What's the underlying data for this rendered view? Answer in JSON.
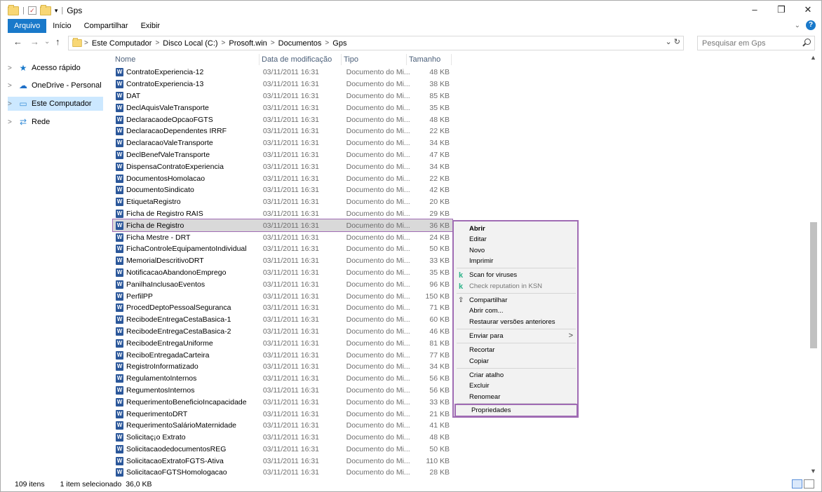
{
  "window": {
    "title": "Gps",
    "controls": {
      "minimize": "–",
      "maximize": "❐",
      "close": "✕"
    }
  },
  "ribbon": {
    "tabs": [
      "Arquivo",
      "Início",
      "Compartilhar",
      "Exibir"
    ],
    "help": "?",
    "collapse": "⌄"
  },
  "address": {
    "back": "←",
    "forward": "→",
    "recent": "⌄",
    "up": "↑",
    "breadcrumbs": [
      "Este Computador",
      "Disco Local (C:)",
      "Prosoft.win",
      "Documentos",
      "Gps"
    ],
    "refresh": "⌄ ↻",
    "search_placeholder": "Pesquisar em Gps"
  },
  "nav": {
    "items": [
      {
        "label": "Acesso rápido",
        "icon": "★"
      },
      {
        "label": "OneDrive - Personal",
        "icon": "☁"
      },
      {
        "label": "Este Computador",
        "icon": "▭"
      },
      {
        "label": "Rede",
        "icon": "⇄"
      }
    ]
  },
  "columns": {
    "name": "Nome",
    "date": "Data de modificação",
    "type": "Tipo",
    "size": "Tamanho"
  },
  "files": [
    {
      "name": "ContratoExperiencia-12",
      "date": "03/11/2011 16:31",
      "type": "Documento do Mi...",
      "size": "48 KB"
    },
    {
      "name": "ContratoExperiencia-13",
      "date": "03/11/2011 16:31",
      "type": "Documento do Mi...",
      "size": "38 KB"
    },
    {
      "name": "DAT",
      "date": "03/11/2011 16:31",
      "type": "Documento do Mi...",
      "size": "85 KB"
    },
    {
      "name": "DeclAquisValeTransporte",
      "date": "03/11/2011 16:31",
      "type": "Documento do Mi...",
      "size": "35 KB"
    },
    {
      "name": "DeclaracaodeOpcaoFGTS",
      "date": "03/11/2011 16:31",
      "type": "Documento do Mi...",
      "size": "48 KB"
    },
    {
      "name": "DeclaracaoDependentes IRRF",
      "date": "03/11/2011 16:31",
      "type": "Documento do Mi...",
      "size": "22 KB"
    },
    {
      "name": "DeclaracaoValeTransporte",
      "date": "03/11/2011 16:31",
      "type": "Documento do Mi...",
      "size": "34 KB"
    },
    {
      "name": "DeclBenefValeTransporte",
      "date": "03/11/2011 16:31",
      "type": "Documento do Mi...",
      "size": "47 KB"
    },
    {
      "name": "DispensaContratoExperiencia",
      "date": "03/11/2011 16:31",
      "type": "Documento do Mi...",
      "size": "34 KB"
    },
    {
      "name": "DocumentosHomolacao",
      "date": "03/11/2011 16:31",
      "type": "Documento do Mi...",
      "size": "22 KB"
    },
    {
      "name": "DocumentoSindicato",
      "date": "03/11/2011 16:31",
      "type": "Documento do Mi...",
      "size": "42 KB"
    },
    {
      "name": "EtiquetaRegistro",
      "date": "03/11/2011 16:31",
      "type": "Documento do Mi...",
      "size": "20 KB"
    },
    {
      "name": "Ficha de Registro RAIS",
      "date": "03/11/2011 16:31",
      "type": "Documento do Mi...",
      "size": "29 KB"
    },
    {
      "name": "Ficha de Registro",
      "date": "03/11/2011 16:31",
      "type": "Documento do Mi...",
      "size": "36 KB",
      "selected": true
    },
    {
      "name": "Ficha Mestre - DRT",
      "date": "03/11/2011 16:31",
      "type": "Documento do Mi...",
      "size": "24 KB"
    },
    {
      "name": "FichaControleEquipamentoIndividual",
      "date": "03/11/2011 16:31",
      "type": "Documento do Mi...",
      "size": "50 KB"
    },
    {
      "name": "MemorialDescritivoDRT",
      "date": "03/11/2011 16:31",
      "type": "Documento do Mi...",
      "size": "33 KB"
    },
    {
      "name": "NotificacaoAbandonoEmprego",
      "date": "03/11/2011 16:31",
      "type": "Documento do Mi...",
      "size": "35 KB"
    },
    {
      "name": "PanilhaInclusaoEventos",
      "date": "03/11/2011 16:31",
      "type": "Documento do Mi...",
      "size": "96 KB"
    },
    {
      "name": "PerfilPP",
      "date": "03/11/2011 16:31",
      "type": "Documento do Mi...",
      "size": "150 KB"
    },
    {
      "name": "ProcedDeptoPessoalSeguranca",
      "date": "03/11/2011 16:31",
      "type": "Documento do Mi...",
      "size": "71 KB"
    },
    {
      "name": "RecibodeEntregaCestaBasica-1",
      "date": "03/11/2011 16:31",
      "type": "Documento do Mi...",
      "size": "60 KB"
    },
    {
      "name": "RecibodeEntregaCestaBasica-2",
      "date": "03/11/2011 16:31",
      "type": "Documento do Mi...",
      "size": "46 KB"
    },
    {
      "name": "RecibodeEntregaUniforme",
      "date": "03/11/2011 16:31",
      "type": "Documento do Mi...",
      "size": "81 KB"
    },
    {
      "name": "ReciboEntregadaCarteira",
      "date": "03/11/2011 16:31",
      "type": "Documento do Mi...",
      "size": "77 KB"
    },
    {
      "name": "RegistroInformatizado",
      "date": "03/11/2011 16:31",
      "type": "Documento do Mi...",
      "size": "34 KB"
    },
    {
      "name": "RegulamentoInternos",
      "date": "03/11/2011 16:31",
      "type": "Documento do Mi...",
      "size": "56 KB"
    },
    {
      "name": "RegumentosInternos",
      "date": "03/11/2011 16:31",
      "type": "Documento do Mi...",
      "size": "56 KB"
    },
    {
      "name": "RequerimentoBeneficioIncapacidade",
      "date": "03/11/2011 16:31",
      "type": "Documento do Mi...",
      "size": "33 KB"
    },
    {
      "name": "RequerimentoDRT",
      "date": "03/11/2011 16:31",
      "type": "Documento do Mi...",
      "size": "21 KB"
    },
    {
      "name": "RequerimentoSalárioMaternidade",
      "date": "03/11/2011 16:31",
      "type": "Documento do Mi...",
      "size": "41 KB"
    },
    {
      "name": "Solicitaç¡o Extrato",
      "date": "03/11/2011 16:31",
      "type": "Documento do Mi...",
      "size": "48 KB"
    },
    {
      "name": "SolicitacaodedocumentosREG",
      "date": "03/11/2011 16:31",
      "type": "Documento do Mi...",
      "size": "50 KB"
    },
    {
      "name": "SolicitacaoExtratoFGTS-Ativa",
      "date": "03/11/2011 16:31",
      "type": "Documento do Mi...",
      "size": "110 KB"
    },
    {
      "name": "SolicitacaoFGTSHomologacao",
      "date": "03/11/2011 16:31",
      "type": "Documento do Mi...",
      "size": "28 KB"
    }
  ],
  "context_menu": {
    "open": "Abrir",
    "edit": "Editar",
    "new": "Novo",
    "print": "Imprimir",
    "scan": "Scan for viruses",
    "reputation": "Check reputation in KSN",
    "share": "Compartilhar",
    "open_with": "Abrir com...",
    "restore": "Restaurar versões anteriores",
    "send_to": "Enviar para",
    "cut": "Recortar",
    "copy": "Copiar",
    "shortcut": "Criar atalho",
    "delete": "Excluir",
    "rename": "Renomear",
    "properties": "Propriedades"
  },
  "status": {
    "count": "109 itens",
    "selected": "1 item selecionado",
    "size": "36,0 KB"
  },
  "colors": {
    "accent": "#1979ca",
    "highlight": "#a06cb4",
    "kaspersky": "#2db389"
  }
}
